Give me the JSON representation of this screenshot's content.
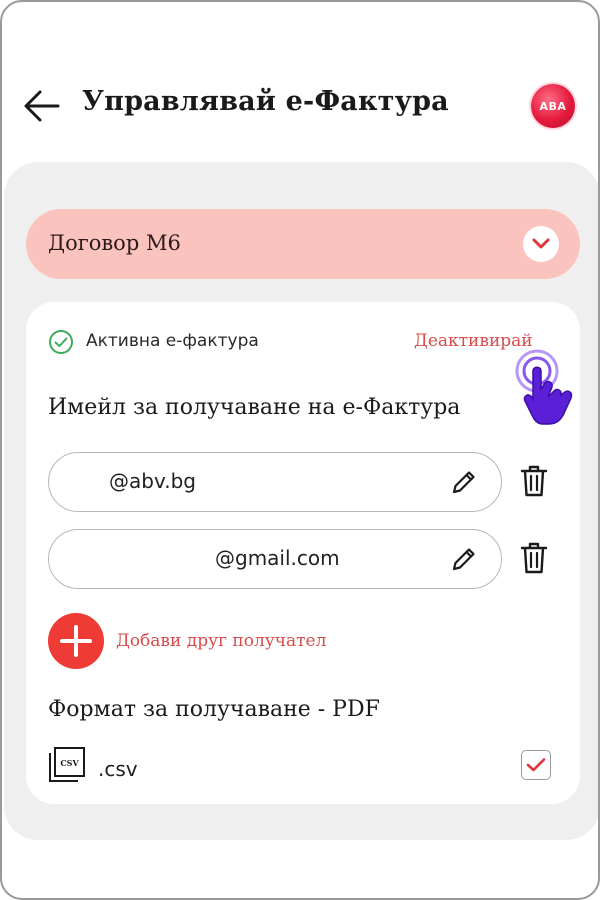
{
  "header": {
    "title": "Управлявай е-Фактура",
    "logo_text": "ABA"
  },
  "contract": {
    "label": "Договор М6"
  },
  "status": {
    "label": "Активна е-фактура",
    "action_label": "Деактивирай"
  },
  "emails": {
    "heading": "Имейл за получаване на е-Фактура",
    "items": [
      {
        "value": "@abv.bg"
      },
      {
        "value": "@gmail.com"
      }
    ],
    "add_label": "Добави друг получател"
  },
  "format": {
    "heading": "Формат за получаване - PDF",
    "csv_icon_text": "CSV",
    "csv_label": ".csv",
    "csv_checked": true
  },
  "colors": {
    "accent_red": "#ee3b36",
    "link_red": "#d94a4a",
    "contract_bg": "#fbc3bd",
    "panel_bg": "#efefef",
    "success_green": "#3daa5a",
    "hand_purple": "#5a1fd6"
  },
  "icons": [
    "back-arrow-icon",
    "logo",
    "chevron-down-icon",
    "check-circle-icon",
    "tap-hand-icon",
    "pencil-icon",
    "trash-icon",
    "plus-icon",
    "csv-file-icon",
    "checkmark-icon"
  ]
}
